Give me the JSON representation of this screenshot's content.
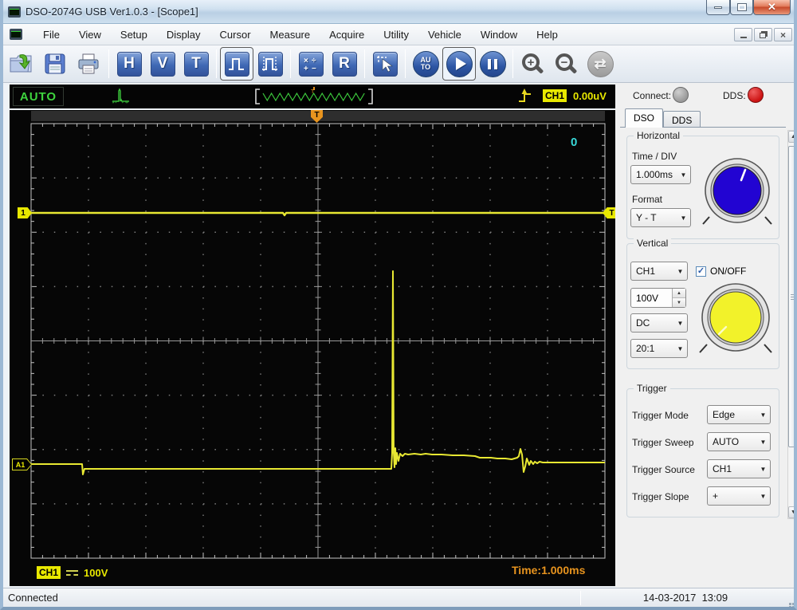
{
  "window": {
    "title": "DSO-2074G USB Ver1.0.3 - [Scope1]"
  },
  "menu": {
    "items": [
      "File",
      "View",
      "Setup",
      "Display",
      "Cursor",
      "Measure",
      "Acquire",
      "Utility",
      "Vehicle",
      "Window",
      "Help"
    ]
  },
  "toolbar": {
    "horizontal_label": "H",
    "vertical_label": "V",
    "trigger_label": "T",
    "ref_label": "R",
    "auto_top": "AU",
    "auto_bottom": "TO",
    "icons": [
      "open-file",
      "save",
      "print",
      "horizontal-setup",
      "vertical-setup",
      "trigger-setup",
      "pulse-single",
      "pulse-train",
      "math",
      "reference",
      "cursor-measure",
      "auto-set",
      "run",
      "pause",
      "zoom-in",
      "zoom-out",
      "transfer"
    ]
  },
  "strip": {
    "acquisition_mode": "AUTO",
    "trigger_channel": "CH1",
    "trigger_level": "0.00uV"
  },
  "scope": {
    "acquisition_count": "0",
    "ch1_marker": "1",
    "math_marker": "A1",
    "trigger_level_marker": "T",
    "trigger_position_marker": "T",
    "channel_label": "CH1",
    "channel_scale": "100V",
    "time_readout": "Time:1.000ms",
    "grid": {
      "cols": 10,
      "rows": 8,
      "minor": 5
    },
    "colors": {
      "trace": "#e8e832",
      "grid_dot": "#7d7d7d",
      "grid_border": "#c4c4c4",
      "center_line": "#989898",
      "preview_green": "#3cc83c",
      "marker_orange": "#e8941e",
      "marker_yellow": "#e8e800",
      "count_cyan": "#38d8d8"
    },
    "waveforms": {
      "ch1": "27,129 343,129 345,132 347,129 747,129",
      "a1": "27,444 91,444 92,457 94,450 479,450 480,430 481,202 482,430 483,448 484,424 485,444 486,430 488,440 490,431 493,434 496,431 500,432 508,431 516,432 522,431 530,432 542,432 556,433 570,433 584,434 590,436 604,436 612,437 622,437 630,438 637,436 639,434 641,425 643,432 645,454 647,447 649,437 652,445 654,440 657,444 659,441 662,443 665,441 669,442 747,442"
    }
  },
  "panel": {
    "connect_label": "Connect:",
    "dds_label": "DDS:",
    "connect_led_color": "#a8a8a8",
    "dds_led_color": "#d41616",
    "tabs": [
      "DSO",
      "DDS"
    ],
    "horizontal": {
      "title": "Horizontal",
      "time_div_label": "Time / DIV",
      "time_div_value": "1.000ms",
      "format_label": "Format",
      "format_value": "Y - T",
      "knob_color": "#2204d2"
    },
    "vertical": {
      "title": "Vertical",
      "channel_value": "CH1",
      "onoff_label": "ON/OFF",
      "onoff_checked": "✓",
      "volt_value": "100V",
      "coupling_value": "DC",
      "probe_value": "20:1",
      "knob_color": "#f2f22a"
    },
    "trigger": {
      "title": "Trigger",
      "rows": [
        {
          "label": "Trigger Mode",
          "value": "Edge"
        },
        {
          "label": "Trigger Sweep",
          "value": "AUTO"
        },
        {
          "label": "Trigger Source",
          "value": "CH1"
        },
        {
          "label": "Trigger Slope",
          "value": "+"
        }
      ]
    }
  },
  "statusbar": {
    "status": "Connected",
    "datetime": "14-03-2017  13:09"
  }
}
